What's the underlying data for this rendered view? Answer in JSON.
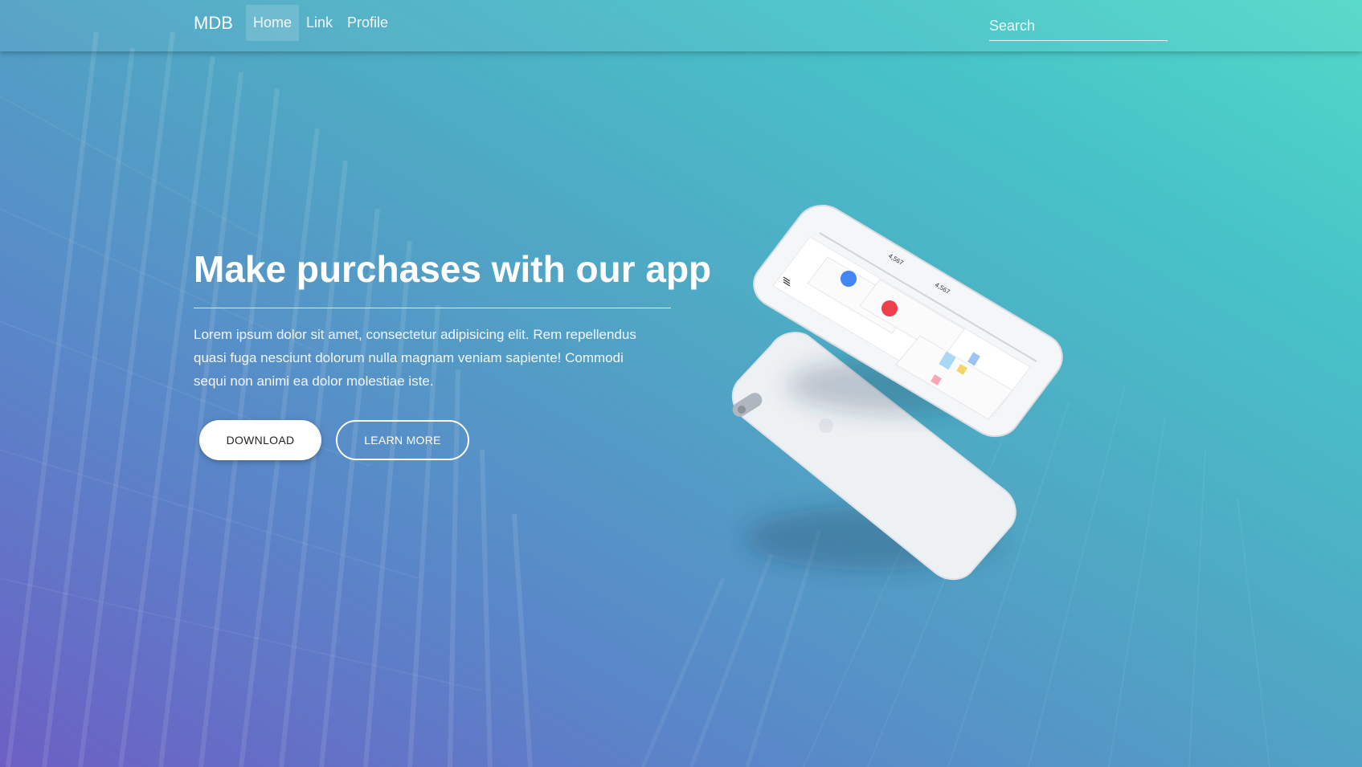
{
  "navbar": {
    "brand": "MDB",
    "links": [
      {
        "label": "Home",
        "active": true
      },
      {
        "label": "Link",
        "active": false
      },
      {
        "label": "Profile",
        "active": false
      }
    ],
    "search_placeholder": "Search"
  },
  "hero": {
    "title": "Make purchases with our app",
    "description": "Lorem ipsum dolor sit amet, consectetur adipisicing elit. Rem repellendus quasi fuga nesciunt dolorum nulla magnam veniam sapiente! Commodi sequi non animi ea dolor molestiae iste.",
    "download_label": "DOWNLOAD",
    "learn_more_label": "LEARN MORE"
  },
  "phone_screen": {
    "stat_1": "4,567",
    "stat_2": "4,567"
  },
  "colors": {
    "gradient_start": "#6c5fc4",
    "gradient_end": "#52d8c8",
    "accent_blue": "#4285f4",
    "accent_red": "#ef3f4a"
  }
}
